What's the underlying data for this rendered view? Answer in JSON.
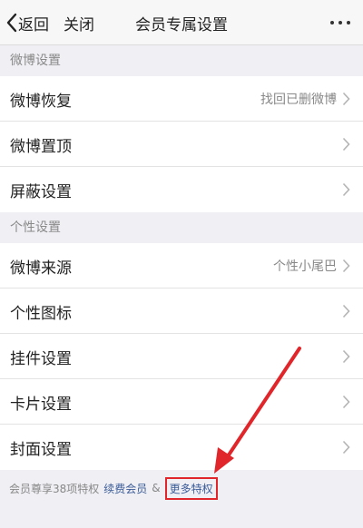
{
  "nav": {
    "back_label": "返回",
    "close_label": "关闭",
    "title": "会员专属设置"
  },
  "sections": [
    {
      "header": "微博设置",
      "rows": [
        {
          "label": "微博恢复",
          "value": "找回已删微博"
        },
        {
          "label": "微博置顶",
          "value": ""
        },
        {
          "label": "屏蔽设置",
          "value": ""
        }
      ]
    },
    {
      "header": "个性设置",
      "rows": [
        {
          "label": "微博来源",
          "value": "个性小尾巴"
        },
        {
          "label": "个性图标",
          "value": ""
        },
        {
          "label": "挂件设置",
          "value": ""
        },
        {
          "label": "卡片设置",
          "value": ""
        },
        {
          "label": "封面设置",
          "value": ""
        }
      ]
    }
  ],
  "footer": {
    "info_text": "会员尊享38项特权",
    "renew_link": "续费会员",
    "amp": "&",
    "more_link": "更多特权"
  },
  "colors": {
    "annotation": "#e0262a",
    "link": "#3b5c98"
  },
  "icons": {
    "back": "chevron-left-icon",
    "more": "more-dots-icon",
    "row": "chevron-right-icon",
    "annotation": "red-arrow-icon"
  }
}
